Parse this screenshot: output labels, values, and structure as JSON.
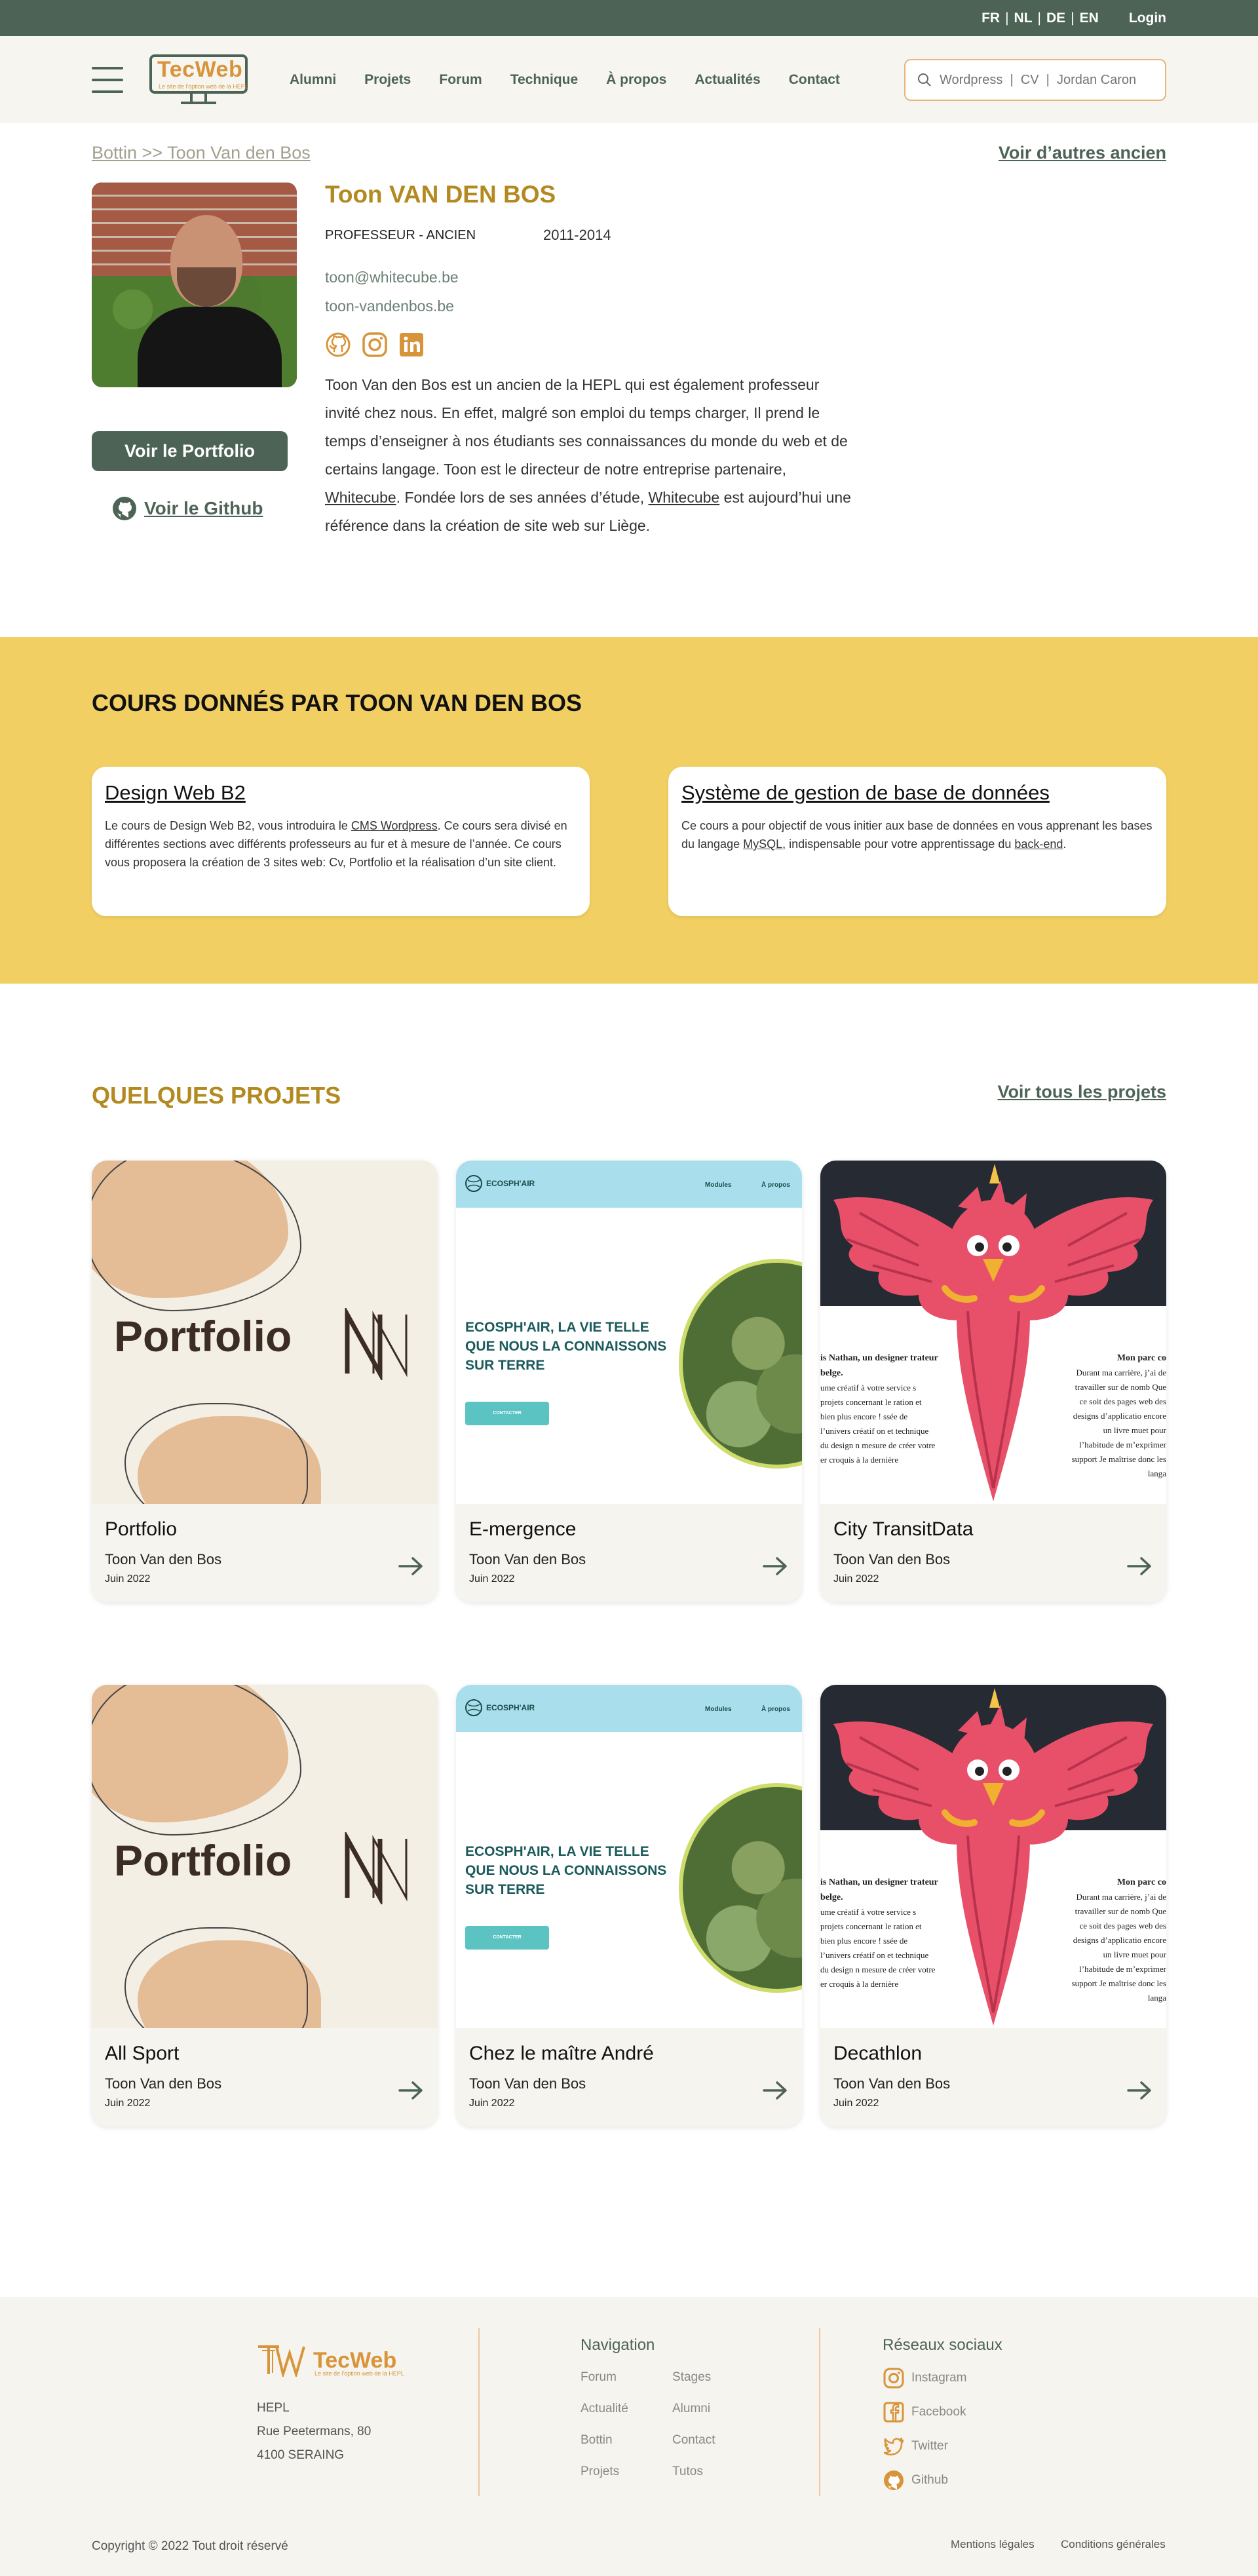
{
  "topbar": {
    "languages": [
      "FR",
      "NL",
      "DE",
      "EN"
    ],
    "separator": "|",
    "login": "Login"
  },
  "header": {
    "logo_text": "TecWeb",
    "logo_sub": "Le site de l'option web de la HEPL",
    "nav": [
      "Alumni",
      "Projets",
      "Forum",
      "Technique",
      "À propos",
      "Actualités",
      "Contact"
    ],
    "search_placeholder": "Wordpress  |  CV  |  Jordan Caron"
  },
  "profile": {
    "breadcrumb": "Bottin >> Toon Van den Bos",
    "other_alumni_link": "Voir d’autres ancien",
    "name": "Toon VAN DEN BOS",
    "role": "PROFESSEUR - ANCIEN",
    "years": "2011-2014",
    "email": "toon@whitecube.be",
    "site": "toon-vandenbos.be",
    "social_icons": [
      "github-icon",
      "instagram-icon",
      "linkedin-icon"
    ],
    "bio_part1": "Toon Van den Bos est un ancien de la HEPL qui est également professeur invité chez nous. En effet, malgré son emploi du temps charger, Il prend le temps d’enseigner à nos étudiants ses connaissances du monde du web et de certains langage. Toon est le directeur de notre entreprise partenaire, ",
    "bio_link1": "Whitecube",
    "bio_part2": ". Fondée lors de ses années d’étude, ",
    "bio_link2": "Whitecube",
    "bio_part3": " est aujourd’hui une référence dans la création de site web sur Liège.",
    "portfolio_button": "Voir le Portfolio",
    "github_link": "Voir le Github"
  },
  "courses": {
    "title": "COURS DONNÉS PAR TOON VAN DEN BOS",
    "items": [
      {
        "title": "Design Web B2",
        "desc_a": "Le cours de Design Web B2, vous introduira le ",
        "desc_link": "CMS Wordpress",
        "desc_b": ". Ce cours sera divisé en différentes sections avec différents professeurs au fur et à mesure de l’année. Ce cours vous proposera la création de 3 sites web: Cv, Portfolio et la réalisation d’un site client."
      },
      {
        "title": "Système de gestion de base de données",
        "desc_a": "Ce cours a pour objectif de vous initier aux base de données en vous apprenant les bases du langage ",
        "desc_link": "MySQL",
        "desc_b": ", indispensable pour votre apprentissage du ",
        "desc_link2": "back-end",
        "desc_c": "."
      }
    ]
  },
  "projects": {
    "title": "QUELQUES PROJETS",
    "see_all": "Voir tous les projets",
    "items": [
      {
        "name": "Portfolio",
        "author": "Toon Van den Bos",
        "date": "Juin 2022",
        "thumb": "portfolio"
      },
      {
        "name": "E-mergence",
        "author": "Toon Van den Bos",
        "date": "Juin 2022",
        "thumb": "ecosph"
      },
      {
        "name": "City TransitData",
        "author": "Toon Van den Bos",
        "date": "Juin 2022",
        "thumb": "bird"
      },
      {
        "name": "All Sport",
        "author": "Toon Van den Bos",
        "date": "Juin 2022",
        "thumb": "portfolio"
      },
      {
        "name": "Chez le maître André",
        "author": "Toon Van den Bos",
        "date": "Juin 2022",
        "thumb": "ecosph"
      },
      {
        "name": "Decathlon",
        "author": "Toon Van den Bos",
        "date": "Juin 2022",
        "thumb": "bird"
      }
    ],
    "thumbs": {
      "portfolio_word": "Portfolio",
      "eco_logo": "ECOSPH'AIR",
      "eco_nav": [
        "Modules",
        "À propos"
      ],
      "eco_headline": "ECOSPH'AIR, LA VIE TELLE QUE NOUS LA CONNAISSONS SUR TERRE",
      "eco_button": "CONTACTER",
      "bird_left_head": "is Nathan, un designer trateur belge.",
      "bird_left_body": "ume créatif à votre service s projets concernant le ration et bien plus encore ! ssée de l’univers créatif on et technique du design n mesure de créer votre er croquis à la dernière",
      "bird_right_head": "Mon parc co",
      "bird_right_body": "Durant ma carrière, j’ai de travailler sur de nomb Que ce soit des pages web des designs d’applicatio encore un livre muet pour l’habitude de m’exprimer support Je maîtrise donc les langa"
    }
  },
  "footer": {
    "logo_text": "TecWeb",
    "logo_sub": "Le site de l'option web de la HEPL",
    "address": [
      "HEPL",
      "Rue Peetermans, 80",
      "4100 SERAING"
    ],
    "nav_title": "Navigation",
    "nav_links": [
      "Forum",
      "Stages",
      "Actualité",
      "Alumni",
      "Bottin",
      "Contact",
      "Projets",
      "Tutos"
    ],
    "social_title": "Réseaux sociaux",
    "socials": [
      {
        "label": "Instagram",
        "icon": "instagram-icon"
      },
      {
        "label": "Facebook",
        "icon": "facebook-icon"
      },
      {
        "label": "Twitter",
        "icon": "twitter-icon"
      },
      {
        "label": "Github",
        "icon": "github-icon"
      }
    ],
    "copyright": "Copyright © 2022 Tout droit réservé",
    "legal": "Mentions légales",
    "conditions": "Conditions générales"
  },
  "colors": {
    "primary_green": "#4d6356",
    "gold": "#b38a1f",
    "orange": "#d8943a",
    "yellow_band": "#f2cf63",
    "cream": "#f6f4ee"
  }
}
